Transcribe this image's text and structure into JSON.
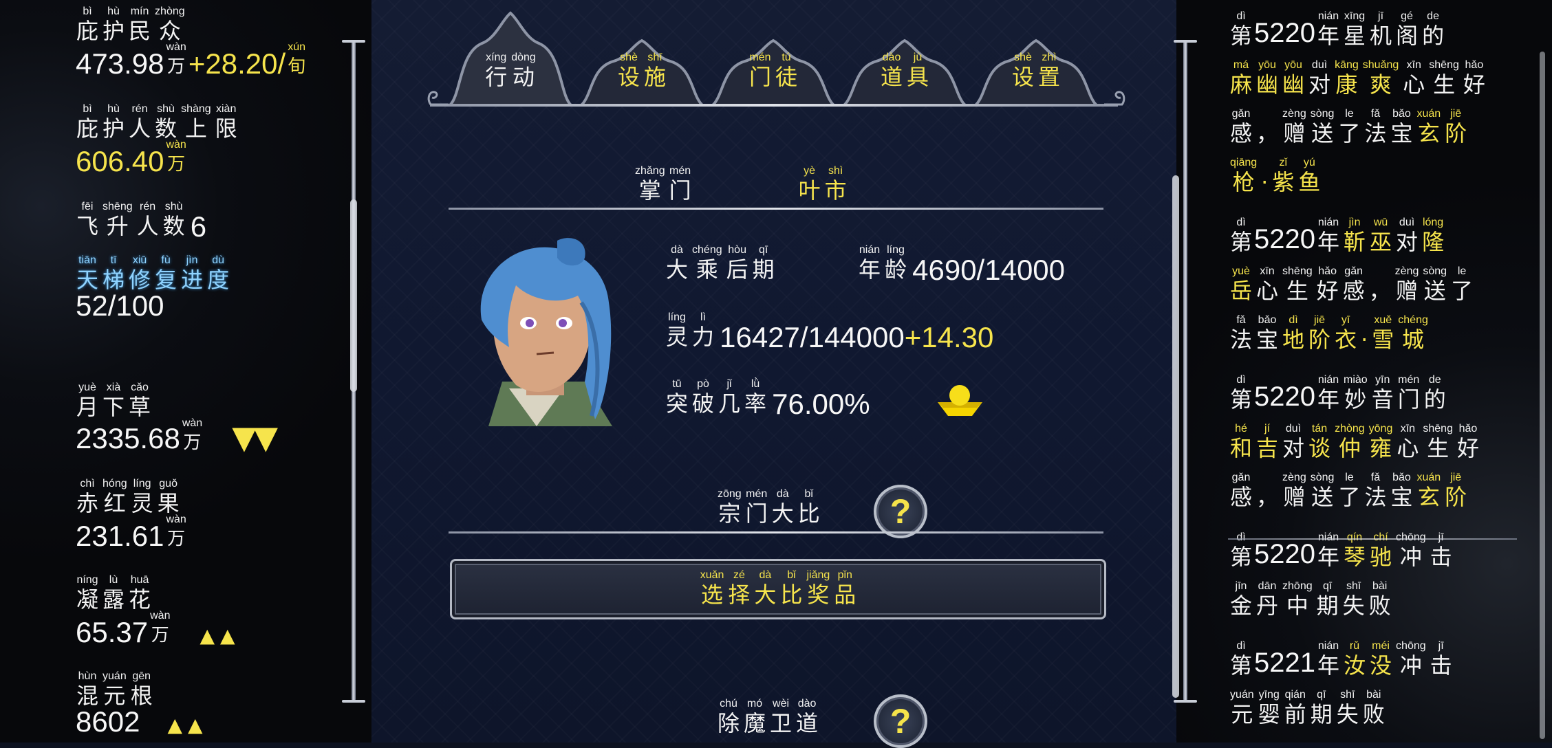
{
  "left_panel": {
    "items": [
      {
        "label": [
          {
            "py": "bì",
            "hz": "庇"
          },
          {
            "py": "hù",
            "hz": "护"
          },
          {
            "py": "mín",
            "hz": "民"
          },
          {
            "py": "zhòng",
            "hz": "众"
          }
        ],
        "value": "473.98",
        "unit": {
          "py": "wàn",
          "hz": "万"
        },
        "delta": "+28.20/",
        "delta_unit": {
          "py": "xún",
          "hz": "旬"
        }
      },
      {
        "label": [
          {
            "py": "bì",
            "hz": "庇"
          },
          {
            "py": "hù",
            "hz": "护"
          },
          {
            "py": "rén",
            "hz": "人"
          },
          {
            "py": "shù",
            "hz": "数"
          },
          {
            "py": "shàng",
            "hz": "上"
          },
          {
            "py": "xiàn",
            "hz": "限"
          }
        ],
        "value": "606.40",
        "unit": {
          "py": "wàn",
          "hz": "万"
        }
      },
      {
        "label": [
          {
            "py": "fēi",
            "hz": "飞"
          },
          {
            "py": "shēng",
            "hz": "升"
          },
          {
            "py": "rén",
            "hz": "人"
          },
          {
            "py": "shù",
            "hz": "数"
          }
        ],
        "value": "6"
      },
      {
        "label": [
          {
            "py": "tiān",
            "hz": "天"
          },
          {
            "py": "tī",
            "hz": "梯"
          },
          {
            "py": "xiū",
            "hz": "修"
          },
          {
            "py": "fù",
            "hz": "复"
          },
          {
            "py": "jìn",
            "hz": "进"
          },
          {
            "py": "dù",
            "hz": "度"
          }
        ],
        "value": "52/100"
      },
      {
        "label": [
          {
            "py": "yuè",
            "hz": "月"
          },
          {
            "py": "xià",
            "hz": "下"
          },
          {
            "py": "cǎo",
            "hz": "草"
          }
        ],
        "value": "2335.68",
        "unit": {
          "py": "wàn",
          "hz": "万"
        },
        "trend": "down"
      },
      {
        "label": [
          {
            "py": "chì",
            "hz": "赤"
          },
          {
            "py": "hóng",
            "hz": "红"
          },
          {
            "py": "líng",
            "hz": "灵"
          },
          {
            "py": "guǒ",
            "hz": "果"
          }
        ],
        "value": "231.61",
        "unit": {
          "py": "wàn",
          "hz": "万"
        }
      },
      {
        "label": [
          {
            "py": "níng",
            "hz": "凝"
          },
          {
            "py": "lù",
            "hz": "露"
          },
          {
            "py": "huā",
            "hz": "花"
          }
        ],
        "value": "65.37",
        "unit": {
          "py": "wàn",
          "hz": "万"
        },
        "trend": "up"
      },
      {
        "label": [
          {
            "py": "hùn",
            "hz": "混"
          },
          {
            "py": "yuán",
            "hz": "元"
          },
          {
            "py": "gēn",
            "hz": "根"
          }
        ],
        "value": "8602",
        "trend": "up"
      }
    ]
  },
  "tabs": [
    {
      "label": [
        {
          "py": "xíng",
          "hz": "行"
        },
        {
          "py": "dòng",
          "hz": "动"
        }
      ],
      "active": true
    },
    {
      "label": [
        {
          "py": "shè",
          "hz": "设"
        },
        {
          "py": "shī",
          "hz": "施"
        }
      ]
    },
    {
      "label": [
        {
          "py": "mén",
          "hz": "门"
        },
        {
          "py": "tú",
          "hz": "徒"
        }
      ]
    },
    {
      "label": [
        {
          "py": "dào",
          "hz": "道"
        },
        {
          "py": "jù",
          "hz": "具"
        }
      ]
    },
    {
      "label": [
        {
          "py": "shè",
          "hz": "设"
        },
        {
          "py": "zhì",
          "hz": "置"
        }
      ]
    }
  ],
  "leader": {
    "title": [
      {
        "py": "zhǎng",
        "hz": "掌"
      },
      {
        "py": "mén",
        "hz": "门"
      }
    ],
    "name": [
      {
        "py": "yè",
        "hz": "叶"
      },
      {
        "py": "shì",
        "hz": "市"
      }
    ],
    "realm": [
      {
        "py": "dà",
        "hz": "大"
      },
      {
        "py": "chéng",
        "hz": "乘"
      },
      {
        "py": "hòu",
        "hz": "后"
      },
      {
        "py": "qī",
        "hz": "期"
      }
    ],
    "age_label": [
      {
        "py": "nián",
        "hz": "年"
      },
      {
        "py": "líng",
        "hz": "龄"
      }
    ],
    "age": "4690/14000",
    "power_label": [
      {
        "py": "líng",
        "hz": "灵"
      },
      {
        "py": "lì",
        "hz": "力"
      }
    ],
    "power": "16427/144000",
    "power_delta": "+14.30",
    "break_label": [
      {
        "py": "tū",
        "hz": "突"
      },
      {
        "py": "pò",
        "hz": "破"
      },
      {
        "py": "jǐ",
        "hz": "几"
      },
      {
        "py": "lǜ",
        "hz": "率"
      }
    ],
    "break_rate": "76.00%"
  },
  "competition": {
    "title": [
      {
        "py": "zōng",
        "hz": "宗"
      },
      {
        "py": "mén",
        "hz": "门"
      },
      {
        "py": "dà",
        "hz": "大"
      },
      {
        "py": "bǐ",
        "hz": "比"
      }
    ],
    "select_button": [
      {
        "py": "xuǎn",
        "hz": "选"
      },
      {
        "py": "zé",
        "hz": "择"
      },
      {
        "py": "dà",
        "hz": "大"
      },
      {
        "py": "bǐ",
        "hz": "比"
      },
      {
        "py": "jiǎng",
        "hz": "奖"
      },
      {
        "py": "pǐn",
        "hz": "品"
      }
    ],
    "help": "?"
  },
  "demon": {
    "title": [
      {
        "py": "chú",
        "hz": "除"
      },
      {
        "py": "mó",
        "hz": "魔"
      },
      {
        "py": "wèi",
        "hz": "卫"
      },
      {
        "py": "dào",
        "hz": "道"
      }
    ],
    "help": "?"
  },
  "log": [
    {
      "lines": [
        [
          {
            "py": "dì",
            "hz": "第",
            "c": "w"
          },
          {
            "num": "5220"
          },
          {
            "py": "nián",
            "hz": "年",
            "c": "w"
          },
          {
            "py": "xīng",
            "hz": "星",
            "c": "w"
          },
          {
            "py": "jī",
            "hz": "机",
            "c": "w"
          },
          {
            "py": "gé",
            "hz": "阁",
            "c": "w"
          },
          {
            "py": "de",
            "hz": "的",
            "c": "w"
          }
        ],
        [
          {
            "py": "má",
            "hz": "麻",
            "c": "y"
          },
          {
            "py": "yōu",
            "hz": "幽",
            "c": "y"
          },
          {
            "py": "yōu",
            "hz": "幽",
            "c": "y"
          },
          {
            "py": "duì",
            "hz": "对",
            "c": "w"
          },
          {
            "py": "kāng",
            "hz": "康",
            "c": "y"
          },
          {
            "py": "shuǎng",
            "hz": "爽",
            "c": "y"
          },
          {
            "py": "xīn",
            "hz": "心",
            "c": "w"
          },
          {
            "py": "shēng",
            "hz": "生",
            "c": "w"
          },
          {
            "py": "hǎo",
            "hz": "好",
            "c": "w"
          }
        ],
        [
          {
            "py": "gǎn",
            "hz": "感",
            "c": "w"
          },
          {
            "py": "",
            "hz": "，",
            "c": "w"
          },
          {
            "py": "zèng",
            "hz": "赠",
            "c": "w"
          },
          {
            "py": "sòng",
            "hz": "送",
            "c": "w"
          },
          {
            "py": "le",
            "hz": "了",
            "c": "w"
          },
          {
            "py": "fǎ",
            "hz": "法",
            "c": "w"
          },
          {
            "py": "bǎo",
            "hz": "宝",
            "c": "w"
          },
          {
            "py": "xuán",
            "hz": "玄",
            "c": "y"
          },
          {
            "py": "jiē",
            "hz": "阶",
            "c": "y"
          }
        ],
        [
          {
            "py": "qiāng",
            "hz": "枪",
            "c": "y"
          },
          {
            "py": "",
            "hz": "·",
            "c": "y"
          },
          {
            "py": "zǐ",
            "hz": "紫",
            "c": "y"
          },
          {
            "py": "yú",
            "hz": "鱼",
            "c": "y"
          }
        ]
      ]
    },
    {
      "lines": [
        [
          {
            "py": "dì",
            "hz": "第",
            "c": "w"
          },
          {
            "num": "5220"
          },
          {
            "py": "nián",
            "hz": "年",
            "c": "w"
          },
          {
            "py": "jìn",
            "hz": "靳",
            "c": "y"
          },
          {
            "py": "wū",
            "hz": "巫",
            "c": "y"
          },
          {
            "py": "duì",
            "hz": "对",
            "c": "w"
          },
          {
            "py": "lóng",
            "hz": "隆",
            "c": "y"
          }
        ],
        [
          {
            "py": "yuè",
            "hz": "岳",
            "c": "y"
          },
          {
            "py": "xīn",
            "hz": "心",
            "c": "w"
          },
          {
            "py": "shēng",
            "hz": "生",
            "c": "w"
          },
          {
            "py": "hǎo",
            "hz": "好",
            "c": "w"
          },
          {
            "py": "gǎn",
            "hz": "感",
            "c": "w"
          },
          {
            "py": "",
            "hz": "，",
            "c": "w"
          },
          {
            "py": "zèng",
            "hz": "赠",
            "c": "w"
          },
          {
            "py": "sòng",
            "hz": "送",
            "c": "w"
          },
          {
            "py": "le",
            "hz": "了",
            "c": "w"
          }
        ],
        [
          {
            "py": "fǎ",
            "hz": "法",
            "c": "w"
          },
          {
            "py": "bǎo",
            "hz": "宝",
            "c": "w"
          },
          {
            "py": "dì",
            "hz": "地",
            "c": "y"
          },
          {
            "py": "jiē",
            "hz": "阶",
            "c": "y"
          },
          {
            "py": "yī",
            "hz": "衣",
            "c": "y"
          },
          {
            "py": "",
            "hz": "·",
            "c": "y"
          },
          {
            "py": "xuě",
            "hz": "雪",
            "c": "y"
          },
          {
            "py": "chéng",
            "hz": "城",
            "c": "y"
          }
        ]
      ]
    },
    {
      "lines": [
        [
          {
            "py": "dì",
            "hz": "第",
            "c": "w"
          },
          {
            "num": "5220"
          },
          {
            "py": "nián",
            "hz": "年",
            "c": "w"
          },
          {
            "py": "miào",
            "hz": "妙",
            "c": "w"
          },
          {
            "py": "yīn",
            "hz": "音",
            "c": "w"
          },
          {
            "py": "mén",
            "hz": "门",
            "c": "w"
          },
          {
            "py": "de",
            "hz": "的",
            "c": "w"
          }
        ],
        [
          {
            "py": "hé",
            "hz": "和",
            "c": "y"
          },
          {
            "py": "jí",
            "hz": "吉",
            "c": "y"
          },
          {
            "py": "duì",
            "hz": "对",
            "c": "w"
          },
          {
            "py": "tán",
            "hz": "谈",
            "c": "y"
          },
          {
            "py": "zhòng",
            "hz": "仲",
            "c": "y"
          },
          {
            "py": "yōng",
            "hz": "雍",
            "c": "y"
          },
          {
            "py": "xīn",
            "hz": "心",
            "c": "w"
          },
          {
            "py": "shēng",
            "hz": "生",
            "c": "w"
          },
          {
            "py": "hǎo",
            "hz": "好",
            "c": "w"
          }
        ],
        [
          {
            "py": "gǎn",
            "hz": "感",
            "c": "w"
          },
          {
            "py": "",
            "hz": "，",
            "c": "w"
          },
          {
            "py": "zèng",
            "hz": "赠",
            "c": "w"
          },
          {
            "py": "sòng",
            "hz": "送",
            "c": "w"
          },
          {
            "py": "le",
            "hz": "了",
            "c": "w"
          },
          {
            "py": "fǎ",
            "hz": "法",
            "c": "w"
          },
          {
            "py": "bǎo",
            "hz": "宝",
            "c": "w"
          },
          {
            "py": "xuán",
            "hz": "玄",
            "c": "y"
          },
          {
            "py": "jiē",
            "hz": "阶",
            "c": "y"
          }
        ]
      ]
    },
    {
      "lines": [
        [
          {
            "py": "dì",
            "hz": "第",
            "c": "w"
          },
          {
            "num": "5220"
          },
          {
            "py": "nián",
            "hz": "年",
            "c": "w"
          },
          {
            "py": "qín",
            "hz": "琴",
            "c": "y"
          },
          {
            "py": "chí",
            "hz": "驰",
            "c": "y"
          },
          {
            "py": "chōng",
            "hz": "冲",
            "c": "w"
          },
          {
            "py": "jī",
            "hz": "击",
            "c": "w"
          }
        ],
        [
          {
            "py": "jīn",
            "hz": "金",
            "c": "w"
          },
          {
            "py": "dān",
            "hz": "丹",
            "c": "w"
          },
          {
            "py": "zhōng",
            "hz": "中",
            "c": "w"
          },
          {
            "py": "qī",
            "hz": "期",
            "c": "w"
          },
          {
            "py": "shī",
            "hz": "失",
            "c": "w"
          },
          {
            "py": "bài",
            "hz": "败",
            "c": "w"
          }
        ]
      ]
    },
    {
      "lines": [
        [
          {
            "py": "dì",
            "hz": "第",
            "c": "w"
          },
          {
            "num": "5221"
          },
          {
            "py": "nián",
            "hz": "年",
            "c": "w"
          },
          {
            "py": "rǔ",
            "hz": "汝",
            "c": "y"
          },
          {
            "py": "méi",
            "hz": "没",
            "c": "y"
          },
          {
            "py": "chōng",
            "hz": "冲",
            "c": "w"
          },
          {
            "py": "jī",
            "hz": "击",
            "c": "w"
          }
        ],
        [
          {
            "py": "yuán",
            "hz": "元",
            "c": "w"
          },
          {
            "py": "yīng",
            "hz": "婴",
            "c": "w"
          },
          {
            "py": "qián",
            "hz": "前",
            "c": "w"
          },
          {
            "py": "qī",
            "hz": "期",
            "c": "w"
          },
          {
            "py": "shī",
            "hz": "失",
            "c": "w"
          },
          {
            "py": "bài",
            "hz": "败",
            "c": "w"
          }
        ]
      ]
    }
  ]
}
